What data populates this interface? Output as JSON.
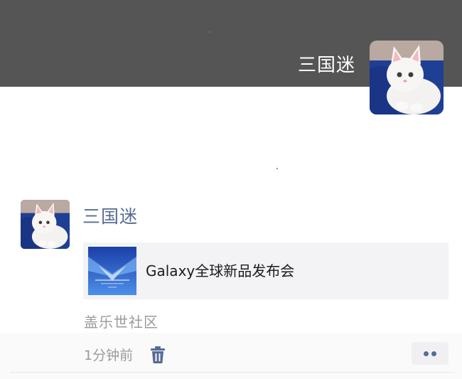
{
  "header": {
    "username": "三国迷",
    "avatar_icon": "white-cat-avatar"
  },
  "post": {
    "author": "三国迷",
    "avatar_icon": "white-cat-avatar",
    "share_card": {
      "title": "Galaxy全球新品发布会",
      "thumbnail_icon": "galaxy-event-thumbnail"
    },
    "source": "盖乐世社区",
    "time": "1分钟前",
    "delete_icon": "trash-icon",
    "more_icon": "more-dots-icon"
  },
  "colors": {
    "cover_bg": "#555555",
    "author_link": "#576b95",
    "meta_text": "#9b9b9b",
    "card_bg": "#f3f3f5"
  }
}
